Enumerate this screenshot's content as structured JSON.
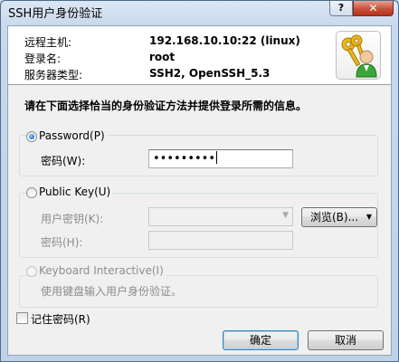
{
  "window": {
    "title": "SSH用户身份验证",
    "help_label": "?",
    "close_label": "✕"
  },
  "connection": {
    "host_label": "远程主机:",
    "host_value": "192.168.10.10:22 (linux)",
    "user_label": "登录名:",
    "user_value": "root",
    "server_label": "服务器类型:",
    "server_value": "SSH2, OpenSSH_5.3",
    "icon": "keys-user-icon"
  },
  "instruction": "请在下面选择恰当的身份验证方法并提供登录所需的信息。",
  "password_method": {
    "label": "Password(P)",
    "selected": true,
    "field_label": "密码(W):",
    "field_value": "•••••••••"
  },
  "publickey_method": {
    "label": "Public Key(U)",
    "selected": false,
    "key_label": "用户密钥(K):",
    "key_value": "",
    "browse_label": "浏览(B)...",
    "passphrase_label": "密码(H):",
    "passphrase_value": ""
  },
  "keyboard_method": {
    "label": "Keyboard Interactive(I)",
    "selected": false,
    "description": "使用键盘输入用户身份验证。"
  },
  "remember": {
    "label": "记住密码(R)",
    "checked": false
  },
  "buttons": {
    "ok": "确定",
    "cancel": "取消"
  },
  "colors": {
    "title_bar": "#c9d9ec",
    "close_button": "#c7503b",
    "dialog_bg": "#f0f0f0"
  }
}
